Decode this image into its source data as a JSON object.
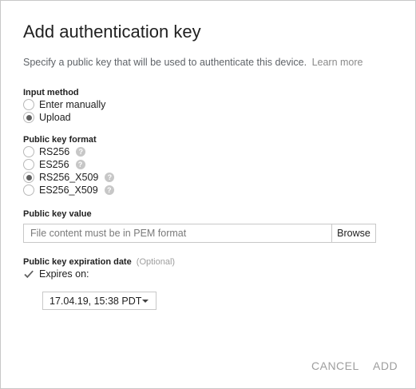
{
  "dialog": {
    "title": "Add authentication key",
    "description": "Specify a public key that will be used to authenticate this device.",
    "learn_more": "Learn more"
  },
  "input_method": {
    "label": "Input method",
    "options": [
      "Enter manually",
      "Upload"
    ],
    "selected": "Upload"
  },
  "key_format": {
    "label": "Public key format",
    "options": [
      "RS256",
      "ES256",
      "RS256_X509",
      "ES256_X509"
    ],
    "selected": "RS256_X509",
    "help_icon": "?"
  },
  "key_value": {
    "label": "Public key value",
    "placeholder": "File content must be in PEM format",
    "browse_label": "Browse"
  },
  "expiration": {
    "label": "Public key expiration date",
    "optional": "(Optional)",
    "checkbox_label": "Expires on:",
    "checked": true,
    "date_value": "17.04.19, 15:38 PDT"
  },
  "footer": {
    "cancel_label": "CANCEL",
    "add_label": "ADD"
  }
}
